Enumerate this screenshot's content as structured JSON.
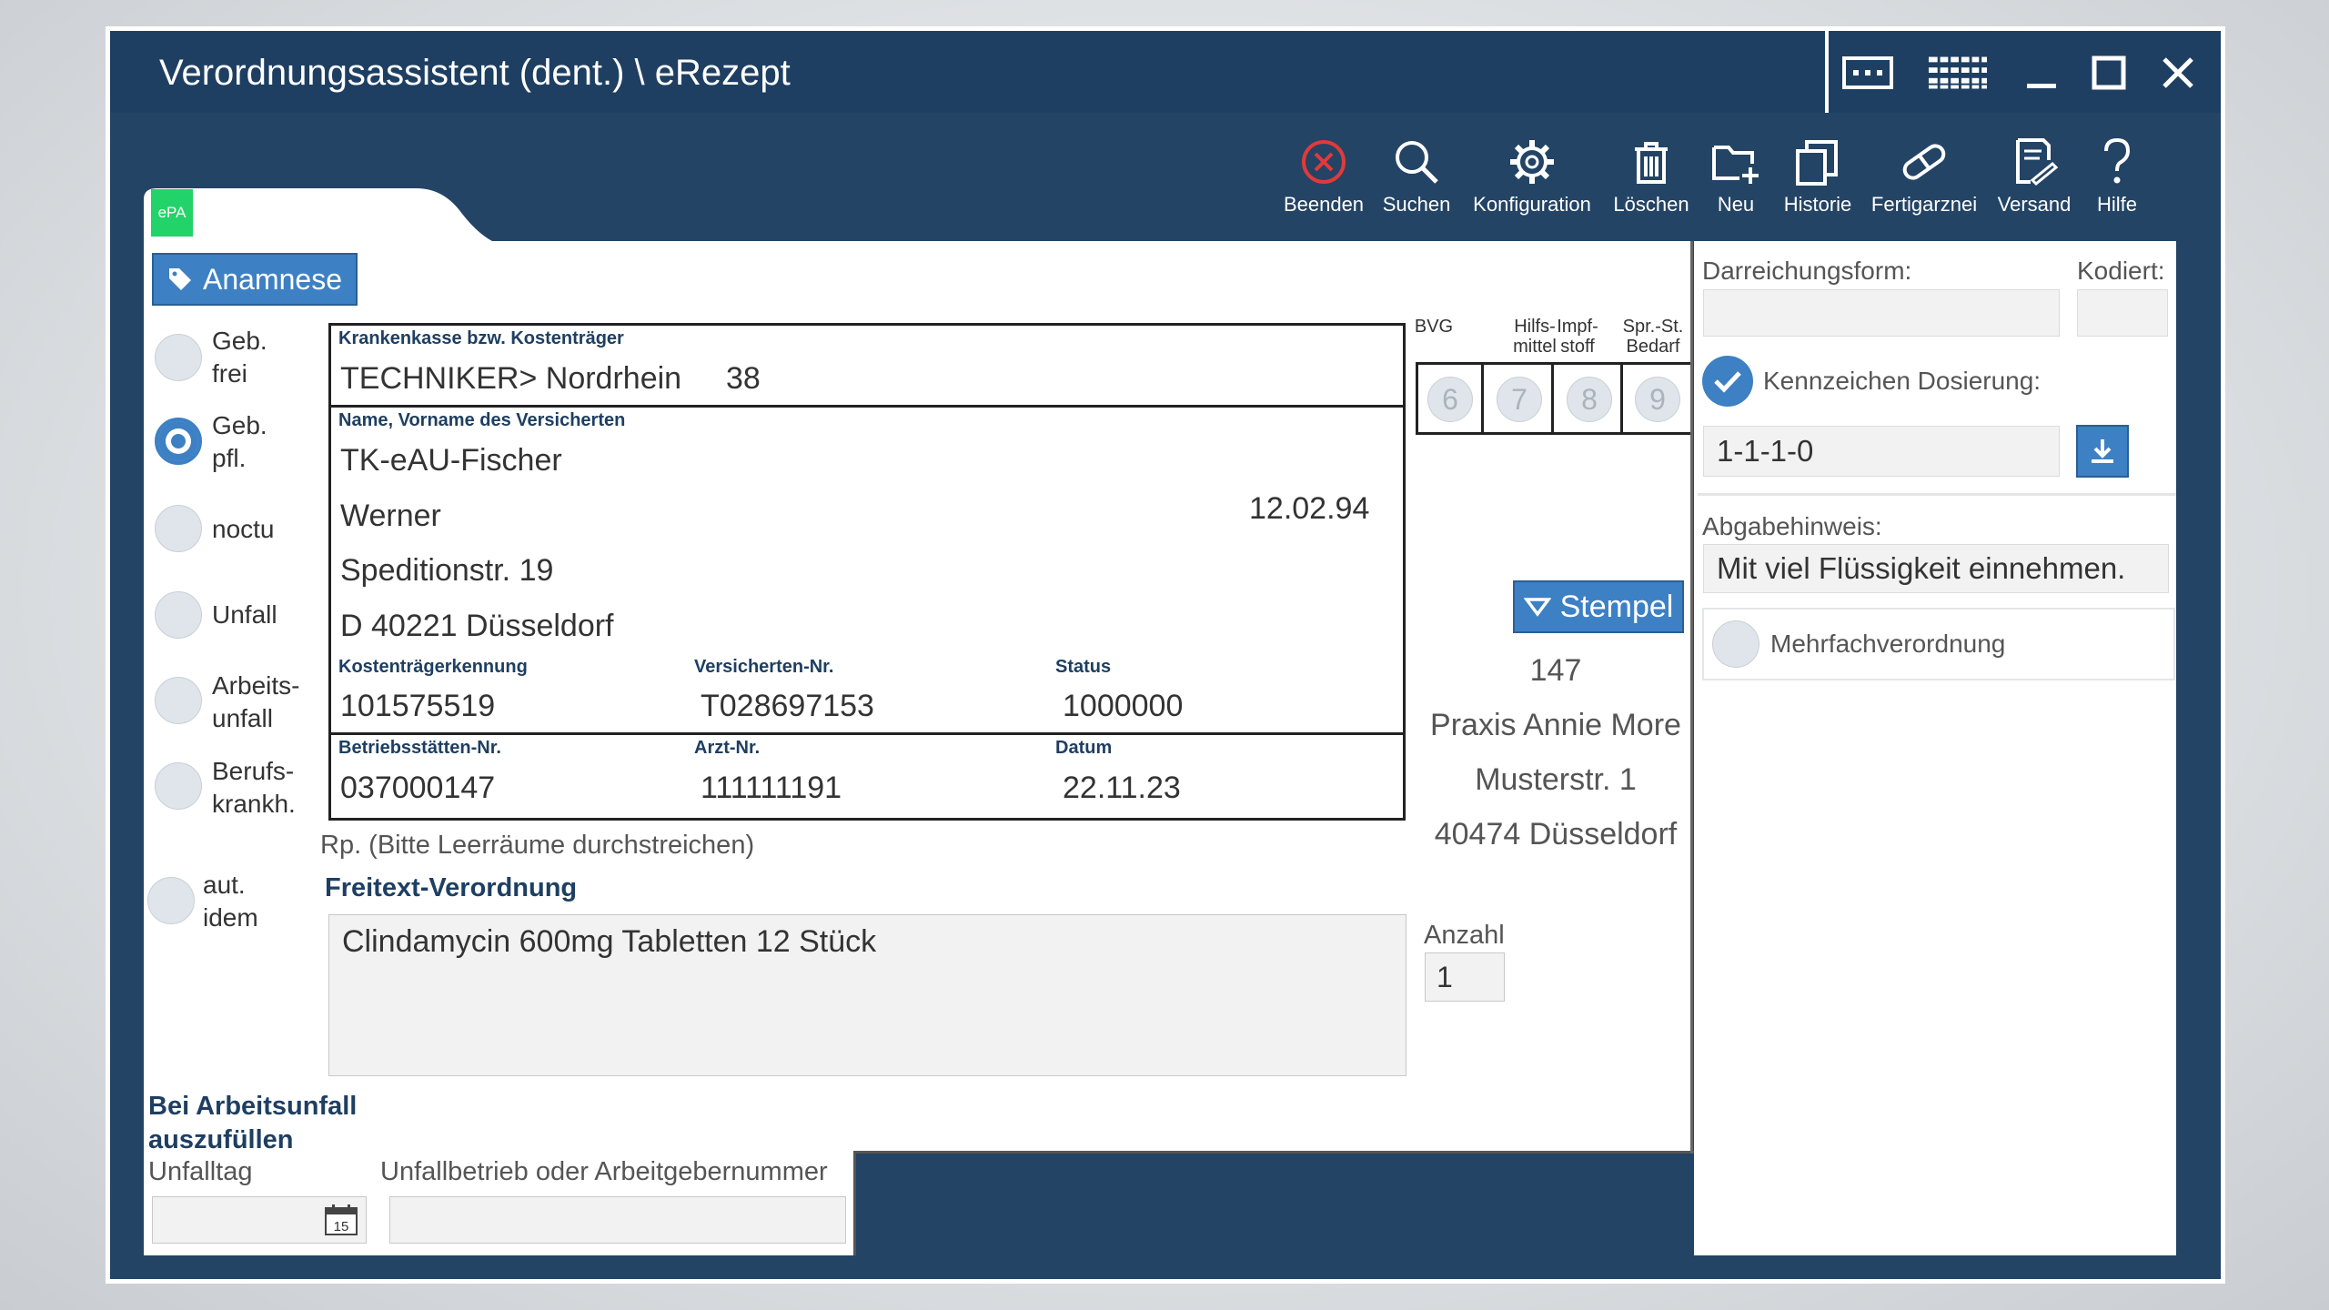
{
  "window": {
    "title": "Verordnungsassistent (dent.) \\ eRezept"
  },
  "toolbar": {
    "items": [
      {
        "label": "Beenden",
        "icon": "close-circle-icon"
      },
      {
        "label": "Suchen",
        "icon": "search-icon"
      },
      {
        "label": "Konfiguration",
        "icon": "gear-icon"
      },
      {
        "label": "Löschen",
        "icon": "trash-icon"
      },
      {
        "label": "Neu",
        "icon": "new-folder-icon"
      },
      {
        "label": "Historie",
        "icon": "history-copy-icon"
      },
      {
        "label": "Fertigarznei",
        "icon": "pill-icon"
      },
      {
        "label": "Versand",
        "icon": "send-document-icon"
      },
      {
        "label": "Hilfe",
        "icon": "question-icon"
      }
    ]
  },
  "epa_badge": "ePA",
  "anamnese_label": "Anamnese",
  "left_options": [
    {
      "label": "Geb.\nfrei",
      "selected": false
    },
    {
      "label": "Geb.\npfl.",
      "selected": true
    },
    {
      "label": "noctu",
      "selected": false
    },
    {
      "label": "Unfall",
      "selected": false
    },
    {
      "label": "Arbeits-\nunfall",
      "selected": false
    },
    {
      "label": "Berufs-\nkrankh.",
      "selected": false
    },
    {
      "label": "aut.\nidem",
      "selected": false
    }
  ],
  "form": {
    "kasse_label": "Krankenkasse bzw. Kostenträger",
    "kasse_value": "TECHNIKER> Nordrhein",
    "kasse_code": "38",
    "name_label": "Name, Vorname des Versicherten",
    "name_line1": "TK-eAU-Fischer",
    "name_line2": "Werner",
    "birthdate": "12.02.94",
    "street": "Speditionstr. 19",
    "city": "D 40221 Düsseldorf",
    "kostentraeger_label": "Kostenträgerkennung",
    "kostentraeger_value": "101575519",
    "versicherten_label": "Versicherten-Nr.",
    "versicherten_value": "T028697153",
    "status_label": "Status",
    "status_value": "1000000",
    "bsnr_label": "Betriebsstätten-Nr.",
    "bsnr_value": "037000147",
    "arzt_label": "Arzt-Nr.",
    "arzt_value": "111111191",
    "datum_label": "Datum",
    "datum_value": "22.11.23"
  },
  "bvg": {
    "columns": [
      {
        "label": "BVG",
        "number": "6"
      },
      {
        "label": "Hilfs-\nmittel",
        "number": "7"
      },
      {
        "label": "Impf-\nstoff",
        "number": "8"
      },
      {
        "label": "Spr.-St.\nBedarf",
        "number": "9"
      }
    ]
  },
  "stamp": {
    "button_label": "Stempel",
    "lines": [
      "147",
      "Praxis Annie More",
      "Musterstr. 1",
      "40474 Düsseldorf"
    ]
  },
  "rp_hint": "Rp. (Bitte Leerräume durchstreichen)",
  "freitext_title": "Freitext-Verordnung",
  "freitext_value": "Clindamycin 600mg Tabletten 12 Stück",
  "anzahl_label": "Anzahl",
  "anzahl_value": "1",
  "arbeitsunfall": {
    "title": "Bei Arbeitsunfall\nauszufüllen",
    "unfalltag_label": "Unfalltag",
    "unfalltag_value": "",
    "calendar_day": "15",
    "unfallbetrieb_label": "Unfallbetrieb oder Arbeitgebernummer",
    "unfallbetrieb_value": ""
  },
  "right_panel": {
    "darreichung_label": "Darreichungsform:",
    "darreichung_value": "",
    "kodiert_label": "Kodiert:",
    "kodiert_value": "",
    "dosierung_label": "Kennzeichen Dosierung:",
    "dosierung_checked": true,
    "dosierung_value": "1-1-1-0",
    "abgabe_label": "Abgabehinweis:",
    "abgabe_value": "Mit viel Flüssigkeit einnehmen.",
    "mehrfach_label": "Mehrfachverordnung",
    "mehrfach_checked": false
  },
  "colors": {
    "titlebar": "#1e3f62",
    "app_background": "#234465",
    "accent": "#3d80c4",
    "epa_green": "#22d36a",
    "beenden_red": "#e03a3a",
    "section_title": "#1e3f62"
  }
}
